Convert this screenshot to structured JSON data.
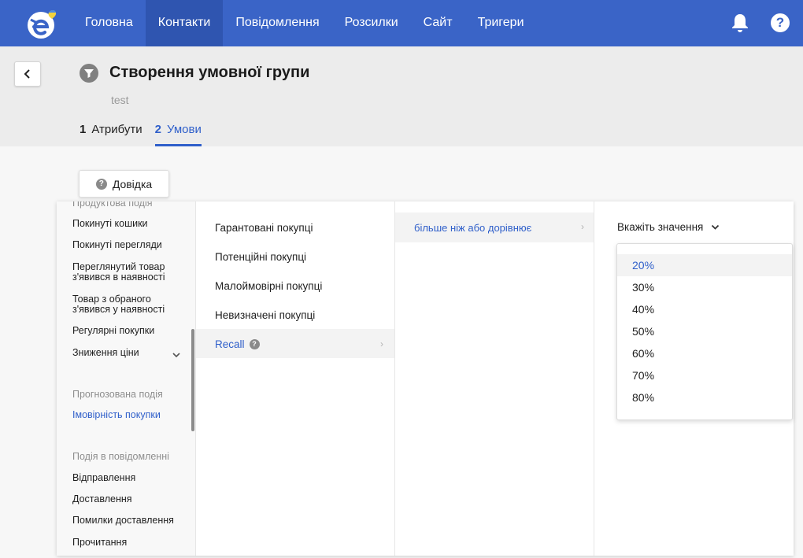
{
  "nav": {
    "items": [
      "Головна",
      "Контакти",
      "Повідомлення",
      "Розсилки",
      "Сайт",
      "Тригери"
    ],
    "active_index": 1,
    "help_glyph": "?"
  },
  "header": {
    "title": "Створення умовної групи",
    "subtitle": "test",
    "steps": [
      {
        "num": "1",
        "label": "Атрибути"
      },
      {
        "num": "2",
        "label": "Умови"
      }
    ],
    "active_step": 1
  },
  "help_button": {
    "label": "Довідка",
    "glyph": "?"
  },
  "categories": {
    "cut_top": "Продуктова подія",
    "items": [
      "Покинуті кошики",
      "Покинуті перегляди",
      "Переглянутий товар з'явився в наявності",
      "Товар з обраного з'явився у наявності",
      "Регулярні покупки",
      "Зниження ціни"
    ],
    "section_predicted": "Прогнозована подія",
    "predicted_item": "Імовірність покупки",
    "section_message": "Подія в повідомленні",
    "message_items": [
      "Відправлення",
      "Доставлення",
      "Помилки доставлення",
      "Прочитання"
    ]
  },
  "options": {
    "items": [
      "Гарантовані покупці",
      "Потенційні покупці",
      "Малоймовірні покупці",
      "Невизначені покупці"
    ],
    "recall_label": "Recall",
    "recall_glyph": "?"
  },
  "condition": {
    "label": "більше ніж або дорівнює"
  },
  "value": {
    "placeholder": "Вкажіть значення",
    "options": [
      "20%",
      "30%",
      "40%",
      "50%",
      "60%",
      "70%",
      "80%"
    ],
    "highlighted_index": 0
  },
  "colors": {
    "nav_bg": "#3a64c7",
    "accent": "#2f5fca"
  }
}
